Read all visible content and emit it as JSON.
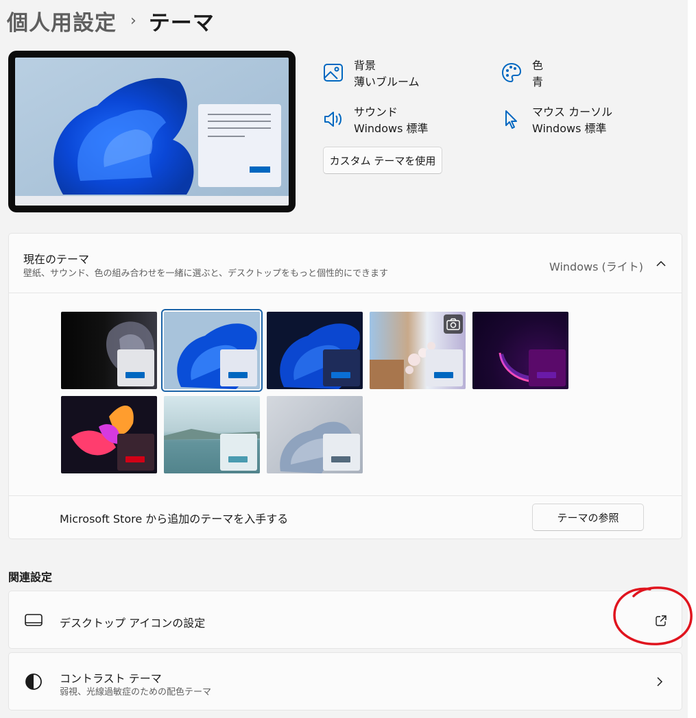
{
  "breadcrumb": {
    "parent": "個人用設定",
    "separator": "›",
    "current": "テーマ"
  },
  "properties": {
    "background": {
      "label": "背景",
      "value": "薄いブルーム",
      "icon": "picture-icon"
    },
    "color": {
      "label": "色",
      "value": "青",
      "icon": "palette-icon"
    },
    "sound": {
      "label": "サウンド",
      "value": "Windows 標準",
      "icon": "speaker-icon"
    },
    "cursor": {
      "label": "マウス カーソル",
      "value": "Windows 標準",
      "icon": "cursor-icon"
    },
    "custom_button": "カスタム テーマを使用"
  },
  "current_theme": {
    "title": "現在のテーマ",
    "subtitle": "壁紙、サウンド、色の組み合わせを一緒に選ぶと、デスクトップをもっと個性的にできます",
    "value": "Windows (ライト)",
    "accent": "#0067c0",
    "themes_count_visible": 8,
    "selected_index": 1
  },
  "store": {
    "text": "Microsoft Store から追加のテーマを入手する",
    "button": "テーマの参照"
  },
  "related": {
    "heading": "関連設定",
    "desktop_icons": {
      "title": "デスクトップ アイコンの設定",
      "icon": "monitor-icon",
      "action_icon": "open-external-icon"
    },
    "contrast": {
      "title": "コントラスト テーマ",
      "subtitle": "弱視、光線過敏症のための配色テーマ",
      "icon": "contrast-icon",
      "action_icon": "chevron-right-icon"
    }
  },
  "annotation": {
    "color": "#e0141e"
  }
}
